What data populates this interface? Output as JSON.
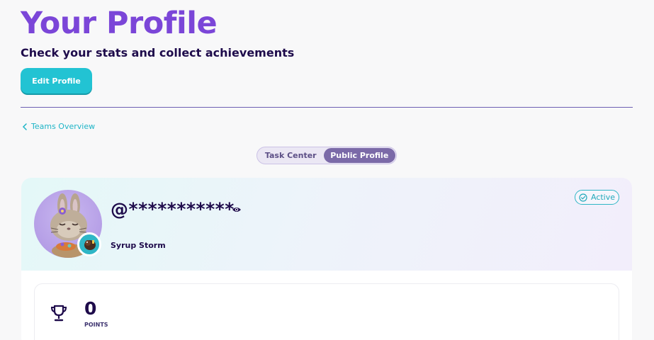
{
  "header": {
    "title": "Your Profile",
    "subtitle": "Check your stats and collect achievements",
    "edit_button": "Edit Profile"
  },
  "breadcrumb": {
    "label": "Teams Overview"
  },
  "tabs": [
    {
      "label": "Task Center",
      "active": false
    },
    {
      "label": "Public Profile",
      "active": true
    }
  ],
  "profile": {
    "username": "@***********",
    "display_name": "Syrup Storm",
    "status": "Active",
    "avatar_icon": "bunny-avatar",
    "badge_icon": "beaver-badge-icon"
  },
  "stats": {
    "points_value": "0",
    "points_label": "POINTS"
  },
  "colors": {
    "title": "#7b46d8",
    "accent": "#22c3d3",
    "toggle_active": "#7b6aa8",
    "text_dark": "#1e0b4b"
  }
}
